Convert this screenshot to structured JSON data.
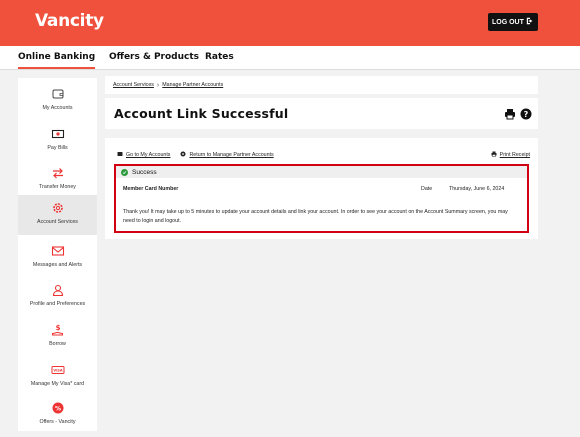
{
  "brand": {
    "logo": "Vancity",
    "accent": "#f0513c"
  },
  "header": {
    "logout_label": "LOG OUT"
  },
  "nav": {
    "tabs": [
      {
        "label": "Online Banking",
        "active": true
      },
      {
        "label": "Offers & Products",
        "active": false
      },
      {
        "label": "Rates",
        "active": false
      }
    ]
  },
  "sidebar": {
    "items": [
      {
        "label": "My Accounts",
        "icon": "wallet-icon"
      },
      {
        "label": "Pay Bills",
        "icon": "bill-icon"
      },
      {
        "label": "Transfer Money",
        "icon": "transfer-icon"
      },
      {
        "label": "Account Services",
        "icon": "gear-icon",
        "active": true
      },
      {
        "label": "Messages and Alerts",
        "icon": "mail-icon"
      },
      {
        "label": "Profile and Preferences",
        "icon": "user-icon"
      },
      {
        "label": "Borrow",
        "icon": "borrow-icon"
      },
      {
        "label": "Manage My Visa* card",
        "icon": "visa-icon"
      },
      {
        "label": "Offers - Vancity",
        "icon": "offers-icon"
      }
    ]
  },
  "breadcrumb": {
    "items": [
      "Account Services",
      "Manage Partner Accounts"
    ]
  },
  "page": {
    "title": "Account Link Successful"
  },
  "actions": {
    "go_accounts": "Go to My Accounts",
    "return_partner": "Return to Manage Partner Accounts",
    "print_receipt": "Print Receipt"
  },
  "result": {
    "status": "Success",
    "status_color": "#2a9a3b",
    "field_label": "Member Card Number",
    "date_label": "Date",
    "date_value": "Thursday, June 6, 2024",
    "message": "Thank you! It may take up to 5 minutes to update your account details and link your account. In order to see your account on the Account Summary screen, you may need to login and logout."
  }
}
